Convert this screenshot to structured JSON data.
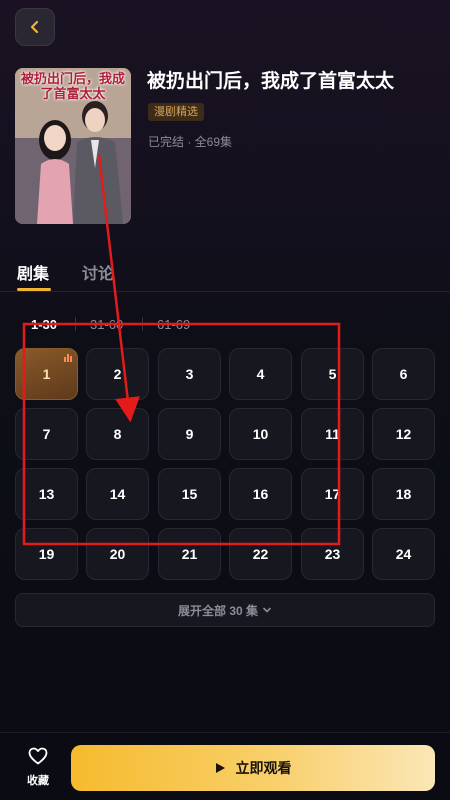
{
  "drama": {
    "cover_title": "被扔出门后，我成了首富太太",
    "title": "被扔出门后，我成了首富太太",
    "tag": "漫剧精选",
    "meta": "已完结 · 全69集"
  },
  "tabs": [
    {
      "label": "剧集"
    },
    {
      "label": "讨论"
    }
  ],
  "ranges": [
    {
      "label": "1-30"
    },
    {
      "label": "31-60"
    },
    {
      "label": "61-69"
    }
  ],
  "episodes": [
    "1",
    "2",
    "3",
    "4",
    "5",
    "6",
    "7",
    "8",
    "9",
    "10",
    "11",
    "12",
    "13",
    "14",
    "15",
    "16",
    "17",
    "18",
    "19",
    "20",
    "21",
    "22",
    "23",
    "24"
  ],
  "current_episode": "1",
  "expand_label": "展开全部 30 集",
  "bottom": {
    "favorite_label": "收藏",
    "watch_label": "立即观看"
  },
  "colors": {
    "accent": "#f2b531",
    "annotation": "#e31b1b"
  },
  "icons": {
    "back": "chevron-left-icon",
    "favorite": "heart-icon",
    "play": "play-icon",
    "expand": "chevron-down-icon",
    "playing": "equalizer-icon"
  }
}
